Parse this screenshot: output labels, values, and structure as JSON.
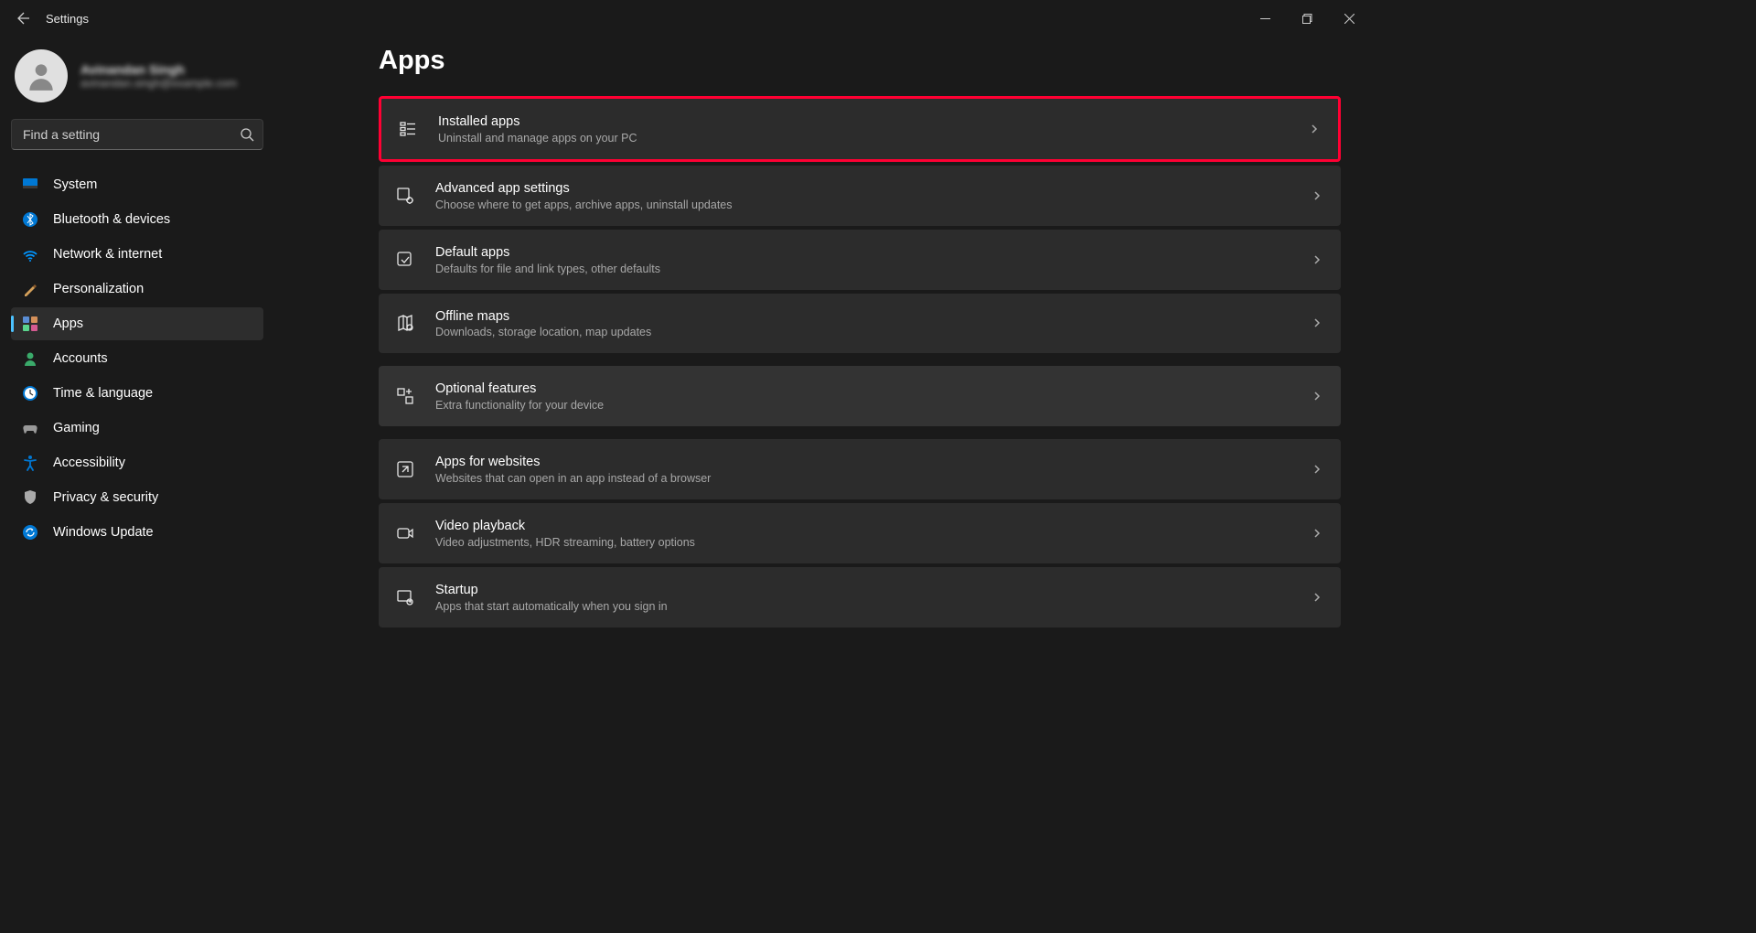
{
  "titlebar": {
    "title": "Settings"
  },
  "profile": {
    "name": "Avinandan Singh",
    "email": "avinandan.singh@example.com"
  },
  "search": {
    "placeholder": "Find a setting"
  },
  "nav": {
    "system": "System",
    "bluetooth": "Bluetooth & devices",
    "network": "Network & internet",
    "personalization": "Personalization",
    "apps": "Apps",
    "accounts": "Accounts",
    "time": "Time & language",
    "gaming": "Gaming",
    "accessibility": "Accessibility",
    "privacy": "Privacy & security",
    "update": "Windows Update"
  },
  "page": {
    "title": "Apps"
  },
  "cards": {
    "installed": {
      "title": "Installed apps",
      "desc": "Uninstall and manage apps on your PC"
    },
    "advanced": {
      "title": "Advanced app settings",
      "desc": "Choose where to get apps, archive apps, uninstall updates"
    },
    "default": {
      "title": "Default apps",
      "desc": "Defaults for file and link types, other defaults"
    },
    "offline": {
      "title": "Offline maps",
      "desc": "Downloads, storage location, map updates"
    },
    "optional": {
      "title": "Optional features",
      "desc": "Extra functionality for your device"
    },
    "websites": {
      "title": "Apps for websites",
      "desc": "Websites that can open in an app instead of a browser"
    },
    "video": {
      "title": "Video playback",
      "desc": "Video adjustments, HDR streaming, battery options"
    },
    "startup": {
      "title": "Startup",
      "desc": "Apps that start automatically when you sign in"
    }
  }
}
